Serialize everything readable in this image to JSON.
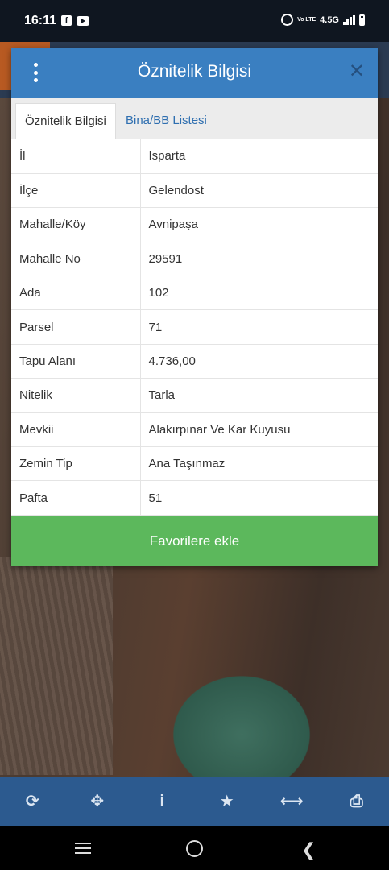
{
  "status_bar": {
    "time": "16:11",
    "network": "4.5G",
    "volte": "Vo LTE"
  },
  "dialog": {
    "title": "Öznitelik Bilgisi",
    "tabs": [
      {
        "label": "Öznitelik Bilgisi",
        "active": true
      },
      {
        "label": "Bina/BB Listesi",
        "active": false
      }
    ],
    "rows": [
      {
        "key": "İl",
        "value": "Isparta"
      },
      {
        "key": "İlçe",
        "value": "Gelendost"
      },
      {
        "key": "Mahalle/Köy",
        "value": "Avnipaşa"
      },
      {
        "key": "Mahalle No",
        "value": "29591"
      },
      {
        "key": "Ada",
        "value": "102"
      },
      {
        "key": "Parsel",
        "value": "71"
      },
      {
        "key": "Tapu Alanı",
        "value": "4.736,00"
      },
      {
        "key": "Nitelik",
        "value": "Tarla"
      },
      {
        "key": "Mevkii",
        "value": "Alakırpınar Ve Kar Kuyusu"
      },
      {
        "key": "Zemin Tip",
        "value": "Ana Taşınmaz"
      },
      {
        "key": "Pafta",
        "value": "51"
      }
    ],
    "favorite_button": "Favorilere ekle"
  },
  "toolbar": {
    "icons": [
      "refresh-icon",
      "locate-icon",
      "info-icon",
      "star-icon",
      "measure-icon",
      "print-icon"
    ]
  },
  "colors": {
    "header": "#3a7fc1",
    "button": "#5cb85c",
    "toolbar": "#2c5a8f"
  }
}
